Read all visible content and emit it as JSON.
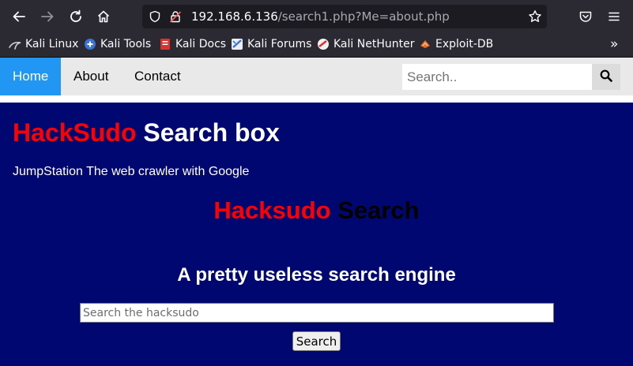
{
  "browser": {
    "url_host": "192.168.6.136",
    "url_path": "/search1.php?Me=about.php",
    "bookmarks": [
      {
        "label": "Kali Linux",
        "icon": "kali-dragon-icon"
      },
      {
        "label": "Kali Tools",
        "icon": "kali-tools-icon"
      },
      {
        "label": "Kali Docs",
        "icon": "kali-docs-icon"
      },
      {
        "label": "Kali Forums",
        "icon": "kali-forums-icon"
      },
      {
        "label": "Kali NetHunter",
        "icon": "kali-nethunter-icon"
      },
      {
        "label": "Exploit-DB",
        "icon": "exploit-db-icon"
      }
    ],
    "overflow_label": "»"
  },
  "nav": {
    "items": [
      "Home",
      "About",
      "Contact"
    ],
    "active": "Home",
    "search_placeholder": "Search.."
  },
  "page": {
    "title_brand": "HackSudo",
    "title_rest": " Search box",
    "subtitle": "JumpStation The web crawler with Google",
    "heading_red": "Hacksudo",
    "heading_dark": " Search",
    "tagline": "A pretty useless search engine",
    "search_placeholder": "Search the hacksudo",
    "search_button": "Search"
  },
  "colors": {
    "page_bg": "#000770",
    "nav_active": "#2196f3",
    "brand_red": "#ff0000"
  }
}
